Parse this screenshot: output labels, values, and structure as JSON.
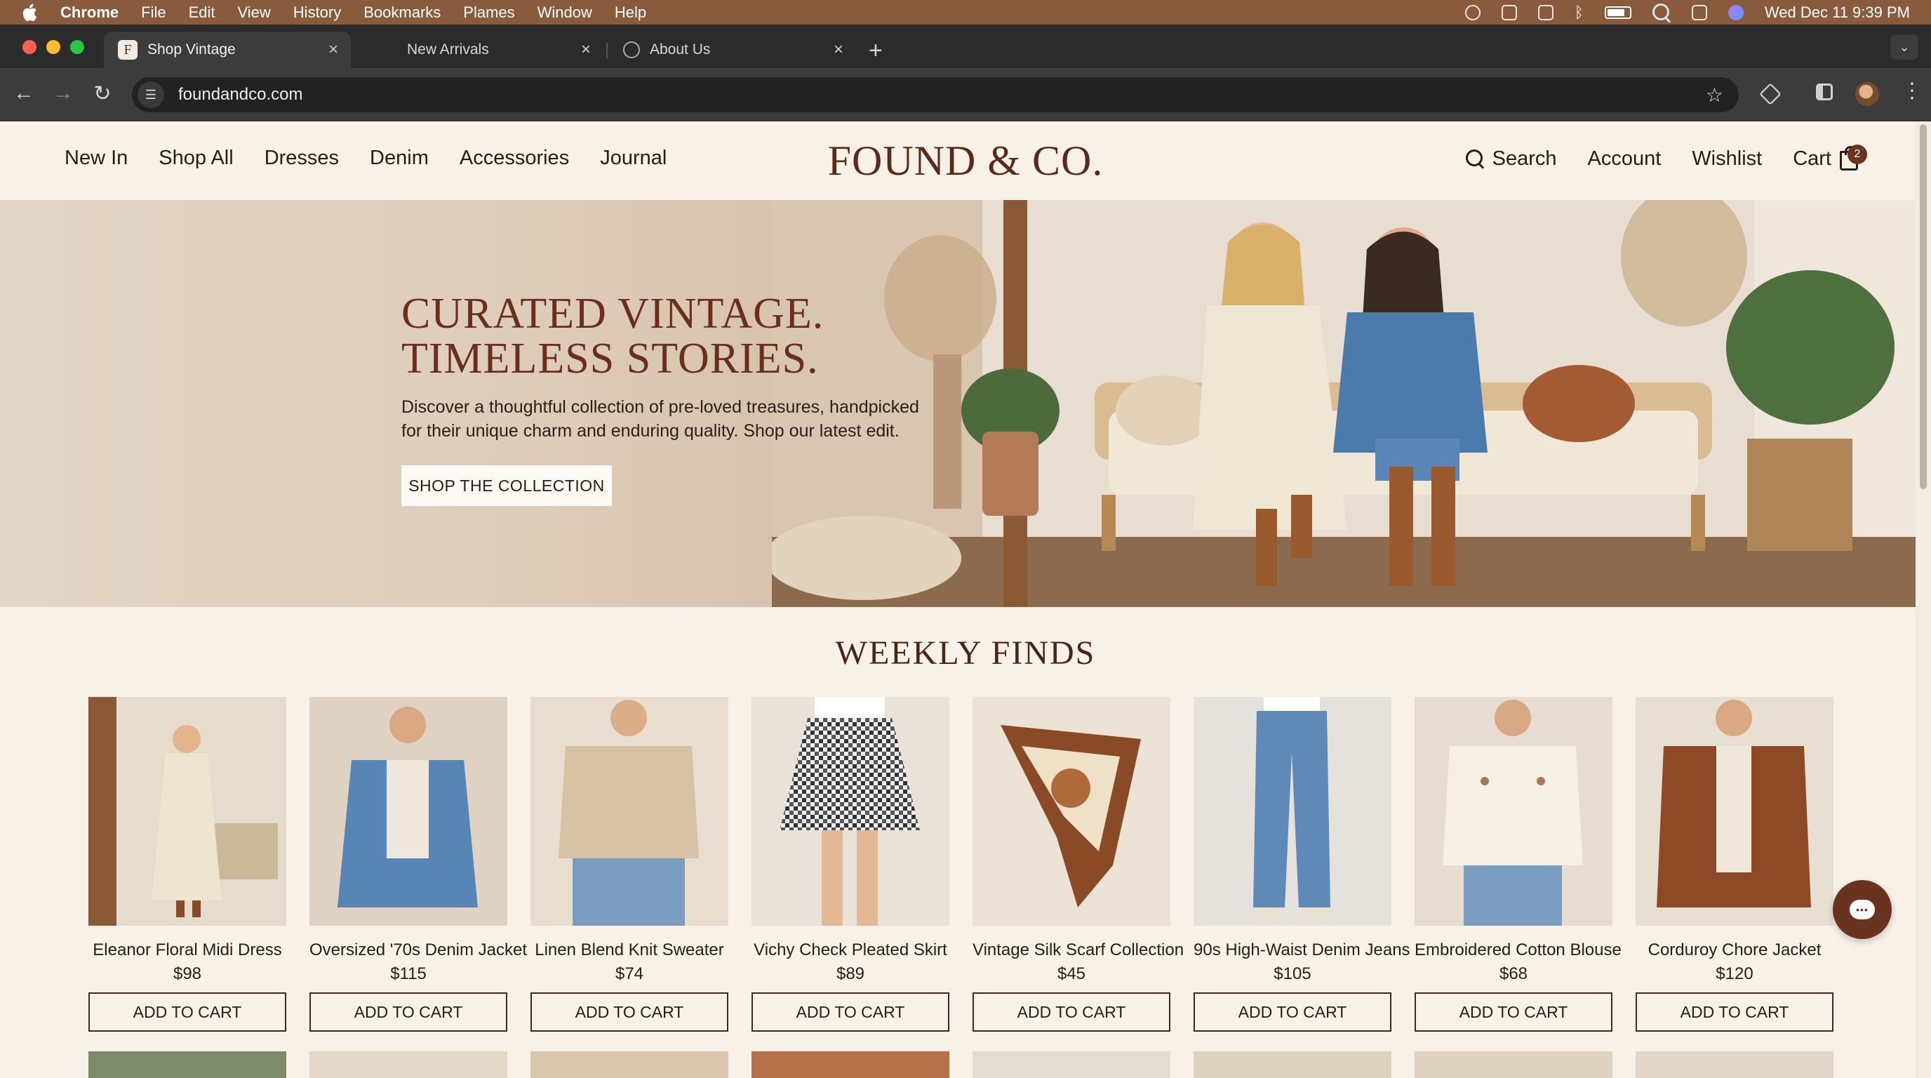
{
  "menubar": {
    "app": "Chrome",
    "items": [
      "File",
      "Edit",
      "View",
      "History",
      "Bookmarks",
      "Plames",
      "Window",
      "Help"
    ],
    "clock": "Wed Dec 11  9:39 PM"
  },
  "tabs": [
    {
      "label": "Shop Vintage",
      "active": true,
      "favicon": "F"
    },
    {
      "label": "New Arrivals",
      "active": false
    },
    {
      "label": "About Us",
      "active": false
    }
  ],
  "toolbar": {
    "url": "foundandco.com"
  },
  "site": {
    "logo": "FOUND & CO.",
    "nav_left": [
      "New In",
      "Shop All",
      "Dresses",
      "Denim",
      "Accessories",
      "Journal"
    ],
    "search_label": "Search",
    "account_label": "Account",
    "wishlist_label": "Wishlist",
    "cart_label": "Cart",
    "cart_count": "2"
  },
  "hero": {
    "title_line1": "CURATED VINTAGE.",
    "title_line2": "TIMELESS STORIES.",
    "subtitle": "Discover a thoughtful collection of pre-loved treasures, handpicked for their unique charm and enduring quality. Shop our latest edit.",
    "cta": "SHOP THE COLLECTION"
  },
  "weekly": {
    "title": "WEEKLY FINDS",
    "add_label": "ADD TO CART",
    "products": [
      {
        "name": "Eleanor Floral Midi Dress",
        "price": "$98"
      },
      {
        "name": "Oversized '70s Denim Jacket",
        "price": "$115"
      },
      {
        "name": "Linen Blend Knit Sweater",
        "price": "$74"
      },
      {
        "name": "Vichy Check Pleated Skirt",
        "price": "$89"
      },
      {
        "name": "Vintage Silk Scarf Collection",
        "price": "$45"
      },
      {
        "name": "90s High-Waist Denim Jeans",
        "price": "$105"
      },
      {
        "name": "Embroidered Cotton Blouse",
        "price": "$68"
      },
      {
        "name": "Corduroy Chore Jacket",
        "price": "$120"
      }
    ]
  },
  "colors": {
    "brand": "#5a2a18",
    "accent": "#6a3320",
    "page_bg": "#f7f1e8"
  }
}
